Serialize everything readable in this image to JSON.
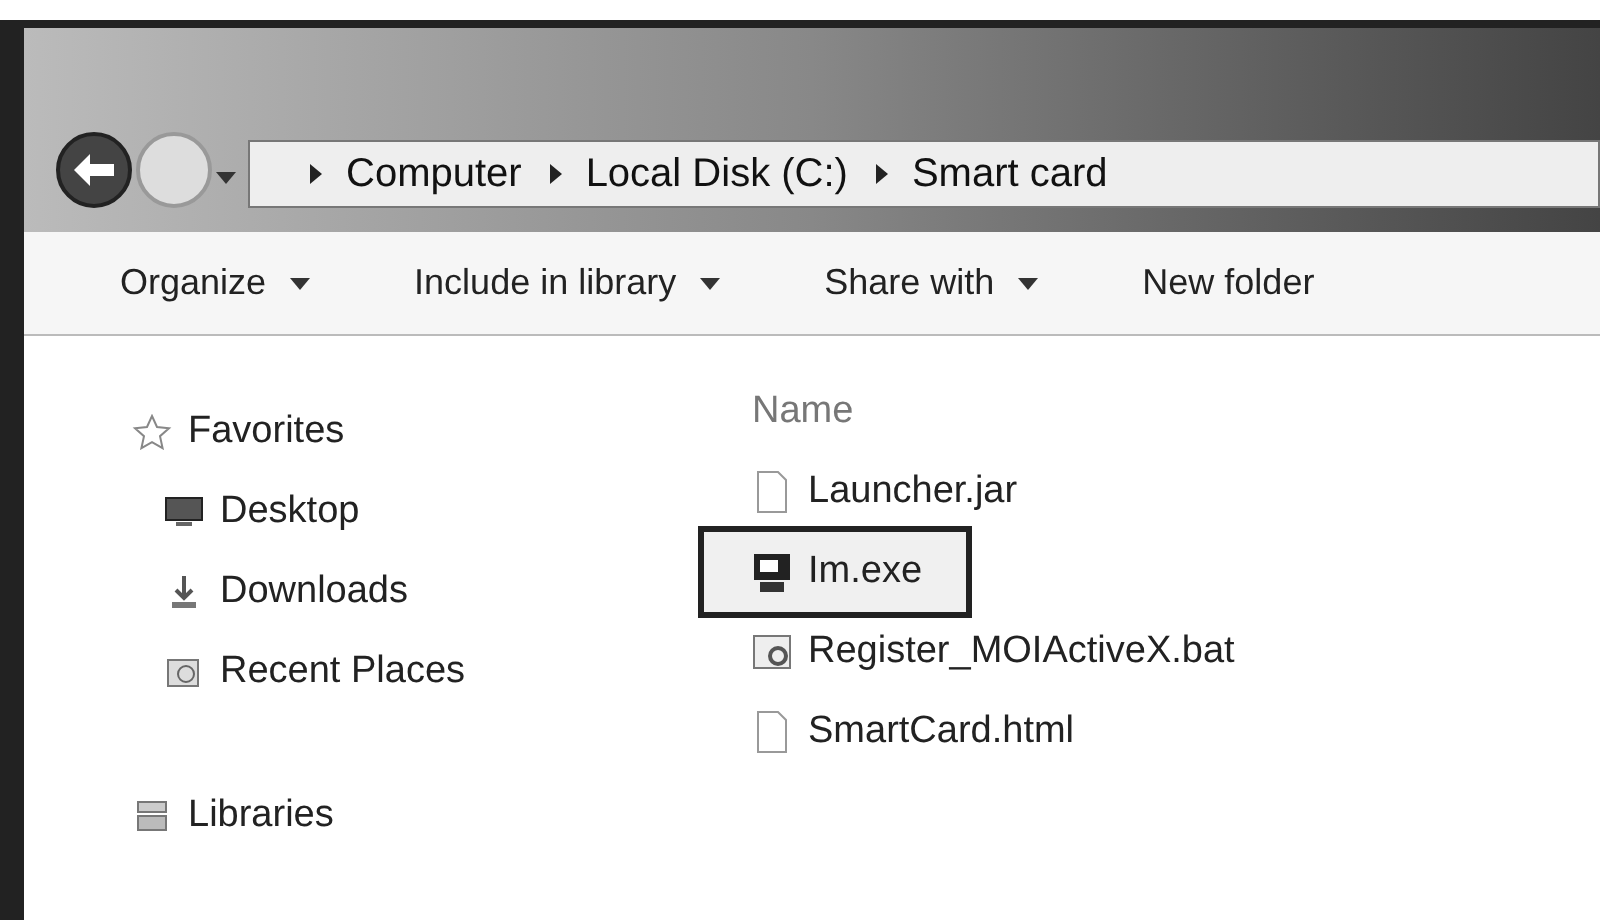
{
  "address_bar": {
    "crumbs": [
      "Computer",
      "Local Disk (C:)",
      "Smart card"
    ]
  },
  "toolbar": {
    "items": [
      {
        "label": "Organize",
        "dropdown": true
      },
      {
        "label": "Include in library",
        "dropdown": true
      },
      {
        "label": "Share with",
        "dropdown": true
      },
      {
        "label": "New folder",
        "dropdown": false
      }
    ]
  },
  "sidebar": {
    "groups": [
      {
        "label": "Favorites",
        "kind": "star",
        "children": [
          {
            "label": "Desktop",
            "kind": "desktop"
          },
          {
            "label": "Downloads",
            "kind": "download"
          },
          {
            "label": "Recent Places",
            "kind": "recent"
          }
        ]
      },
      {
        "label": "Libraries",
        "kind": "library"
      }
    ]
  },
  "file_list": {
    "column": "Name",
    "files": [
      {
        "name": "Launcher.jar",
        "kind": "jar",
        "selected": false
      },
      {
        "name": "Im.exe",
        "kind": "exe",
        "selected": true
      },
      {
        "name": "Register_MOIActiveX.bat",
        "kind": "bat",
        "selected": false
      },
      {
        "name": "SmartCard.html",
        "kind": "html",
        "selected": false
      }
    ]
  }
}
